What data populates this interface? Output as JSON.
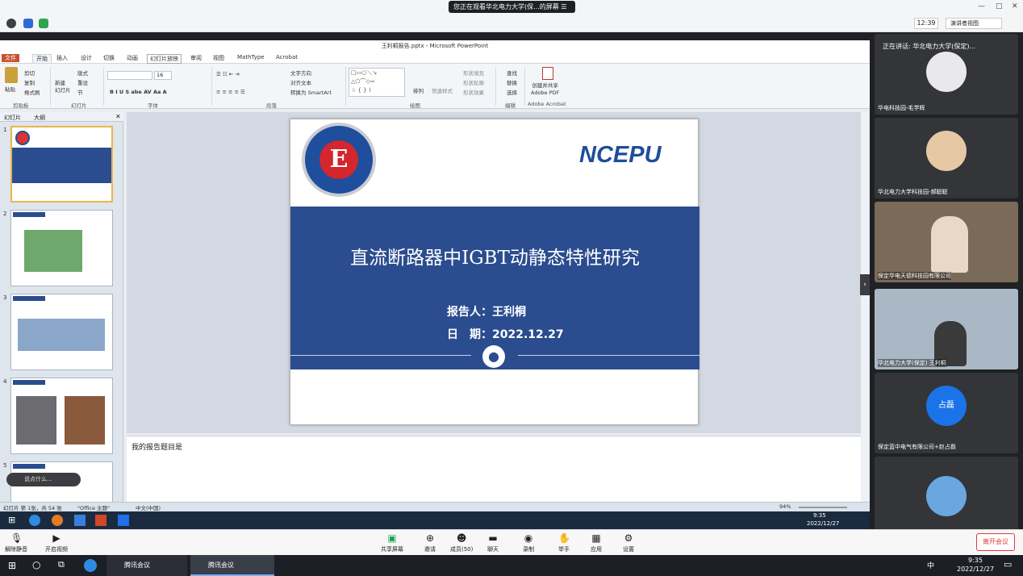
{
  "banner": {
    "text": "您正在观看华北电力大学(保...的屏幕",
    "icon": "menu-icon"
  },
  "topbar": {
    "time": "12:39",
    "view_mode": "演讲者视图"
  },
  "ppt": {
    "window_title": "王利桐报告.pptx - Microsoft PowerPoint",
    "tabs": [
      "文件",
      "开始",
      "插入",
      "设计",
      "切换",
      "动画",
      "幻灯片放映",
      "审阅",
      "视图",
      "MathType",
      "Acrobat"
    ],
    "ribbon": {
      "clipboard": {
        "paste": "粘贴",
        "cut": "剪切",
        "copy": "复制",
        "format": "格式刷",
        "label": "剪贴板"
      },
      "slides": {
        "new": "新建\n幻灯片",
        "layout": "版式",
        "reset": "重设",
        "section": "节",
        "label": "幻灯片"
      },
      "font": {
        "size": "16",
        "label": "字体"
      },
      "paragraph": {
        "dir": "文字方向",
        "align": "对齐文本",
        "smartart": "转换为 SmartArt",
        "label": "段落"
      },
      "drawing": {
        "arrange": "排列",
        "styles": "快速样式",
        "fill": "形状填充",
        "outline": "形状轮廓",
        "effect": "形状效果",
        "label": "绘图"
      },
      "editing": {
        "find": "查找",
        "replace": "替换",
        "select": "选择",
        "label": "编辑"
      },
      "acrobat": {
        "create": "创建并共享\nAdobe PDF",
        "label": "Adobe Acrobat"
      }
    },
    "panel_tabs": [
      "幻灯片",
      "大纲"
    ],
    "thumbs": [
      "1",
      "2",
      "3",
      "4",
      "5"
    ],
    "slide": {
      "brand": "NCEPU",
      "title": "直流断路器中IGBT动静态特性研究",
      "reporter": "报告人：王利桐",
      "date": "日　期：2022.12.27"
    },
    "notes": "我的报告题目是",
    "status": {
      "page": "幻灯片 第 1张，共 54 张",
      "theme": "\"Office 主题\"",
      "lang": "中文(中国)",
      "zoom": "94%"
    },
    "chat_pill": "说点什么...",
    "inner_clock": {
      "time": "9:35",
      "date": "2022/12/27"
    }
  },
  "participants": [
    {
      "name": "华电科技园-毛学辉",
      "header": "正在讲话: 华北电力大学(保定)..."
    },
    {
      "name": "华北电力大学科技园-郝聪聪"
    },
    {
      "name": "保定华电天德科技园有限公司"
    },
    {
      "name": "华北电力大学(保定) 王利桐"
    },
    {
      "name": "保定蓝中电气有限公司+赵占磊",
      "avatar_text": "占磊"
    },
    {
      "name": ""
    }
  ],
  "toolbar": {
    "mute": "解除静音",
    "video": "开启视频",
    "share": "共享屏幕",
    "invite": "邀请",
    "members": "成员(50)",
    "chat": "聊天",
    "record": "录制",
    "raise": "举手",
    "apps": "应用",
    "settings": "设置",
    "leave": "离开会议"
  },
  "taskbar": {
    "app1": "腾讯会议",
    "app2": "腾讯会议",
    "time": "9:35",
    "date": "2022/12/27",
    "ime": "中"
  }
}
